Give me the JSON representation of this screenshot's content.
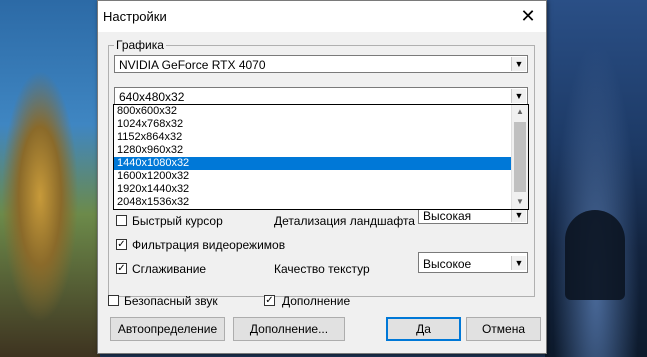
{
  "window": {
    "title": "Настройки",
    "close_glyph": "✕"
  },
  "graphics_group": {
    "label": "Графика",
    "adapter": {
      "value": "NVIDIA GeForce RTX 4070"
    },
    "resolution": {
      "value": "640x480x32"
    },
    "resolution_options": [
      {
        "label": "800x600x32",
        "selected": false
      },
      {
        "label": "1024x768x32",
        "selected": false
      },
      {
        "label": "1152x864x32",
        "selected": false
      },
      {
        "label": "1280x960x32",
        "selected": false
      },
      {
        "label": "1440x1080x32",
        "selected": true
      },
      {
        "label": "1600x1200x32",
        "selected": false
      },
      {
        "label": "1920x1440x32",
        "selected": false
      },
      {
        "label": "2048x1536x32",
        "selected": false
      }
    ],
    "fast_cursor": {
      "label": "Быстрый курсор",
      "checked": false
    },
    "landscape_detail": {
      "label": "Детализация ландшафта",
      "value": "Высокая"
    },
    "mode_filter": {
      "label": "Фильтрация видеорежимов",
      "checked": true
    },
    "smoothing": {
      "label": "Сглаживание",
      "checked": true
    },
    "texture_quality": {
      "label": "Качество текстур",
      "value": "Высокое"
    }
  },
  "safe_sound": {
    "label": "Безопасный звук",
    "checked": false
  },
  "addon": {
    "label": "Дополнение",
    "checked": true
  },
  "buttons": {
    "autodetect": "Автоопределение",
    "addon_more": "Дополнение...",
    "ok": "Да",
    "cancel": "Отмена"
  },
  "colors": {
    "selection": "#0078d7",
    "dialog_bg": "#f0f0f0"
  }
}
